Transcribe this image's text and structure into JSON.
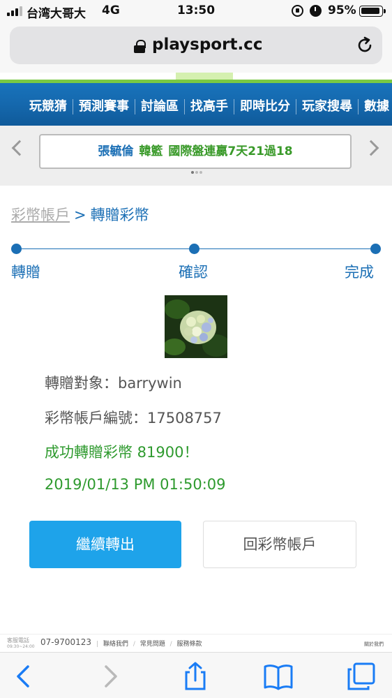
{
  "status_bar": {
    "carrier": "台湾大哥大",
    "network": "4G",
    "time": "13:50",
    "battery_percent": "95%",
    "battery_level": 0.95
  },
  "browser": {
    "url": "playsport.cc",
    "icons": [
      "lock-icon",
      "reload-icon",
      "back-icon",
      "forward-icon",
      "share-icon",
      "bookmarks-icon",
      "tabs-icon"
    ]
  },
  "nav": {
    "items": [
      "玩競猜",
      "預測賽事",
      "討論區",
      "找高手",
      "即時比分",
      "玩家搜尋",
      "數據"
    ]
  },
  "ticker": {
    "name": "張毓倫",
    "team": "韓籃",
    "record": "國際盤連贏7天21過18"
  },
  "breadcrumb": {
    "parent": "彩幣帳戶",
    "separator": ">",
    "current": "轉贈彩幣"
  },
  "steps": {
    "labels": [
      "轉贈",
      "確認",
      "完成"
    ]
  },
  "transfer": {
    "target_line": "轉贈對象：barrywin",
    "account_line": "彩幣帳戶編號：17508757",
    "success_line": "成功轉贈彩幣 81900！",
    "timestamp": "2019/01/13 PM 01:50:09"
  },
  "buttons": {
    "continue_label": "繼續轉出",
    "back_label": "回彩幣帳戶"
  },
  "footer": {
    "service_label": "客服電話",
    "service_hours": "09:30~24:00",
    "phone": "07-9700123",
    "links": [
      "聯絡我們",
      "常見問題",
      "服務條款"
    ],
    "about": "關於我們"
  },
  "colors": {
    "brand_blue": "#1b6fb5",
    "button_blue": "#1ea3ea",
    "success_green": "#2e9a2e"
  }
}
